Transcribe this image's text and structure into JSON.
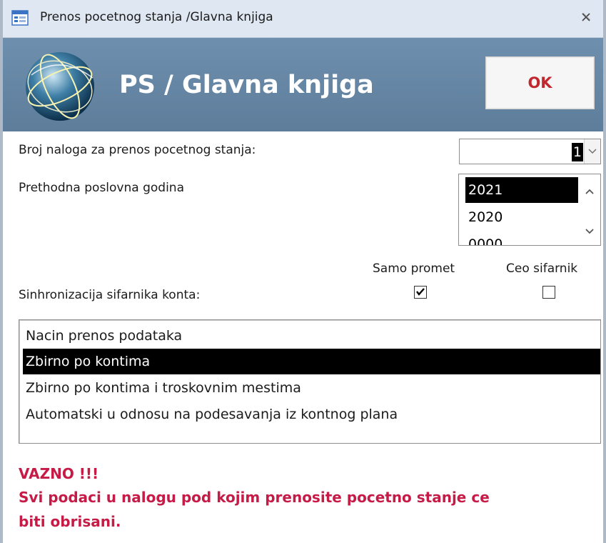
{
  "window": {
    "title": "Prenos pocetnog stanja /Glavna knjiga",
    "icon": "form-icon",
    "close_icon": "close-icon"
  },
  "header": {
    "title": "PS / Glavna knjiga",
    "logo": "globe-icon",
    "ok_label": "OK",
    "accent_color": "#c0282e",
    "band_color": "#6f8fae"
  },
  "form": {
    "order_number_label": "Broj naloga za prenos pocetnog stanja:",
    "order_number_value": "1",
    "prev_year_label": "Prethodna poslovna godina",
    "years": [
      "2021",
      "2020",
      "0000"
    ],
    "selected_year": "2021",
    "sync_label": "Sinhronizacija sifarnika konta:",
    "only_turnover_label": "Samo promet",
    "only_turnover_checked": true,
    "whole_codebook_label": "Ceo sifarnik",
    "whole_codebook_checked": false,
    "methods": [
      "Nacin prenos podataka",
      "Zbirno po kontima",
      "Zbirno po kontima i troskovnim mestima",
      "Automatski u odnosu na podesavanja iz kontnog plana"
    ],
    "selected_method": "Zbirno po kontima"
  },
  "warning": {
    "title": "VAZNO !!!",
    "line1": "Svi podaci u nalogu pod kojim prenosite pocetno stanje ce",
    "line2": "biti obrisani.",
    "color": "#c61b47"
  }
}
